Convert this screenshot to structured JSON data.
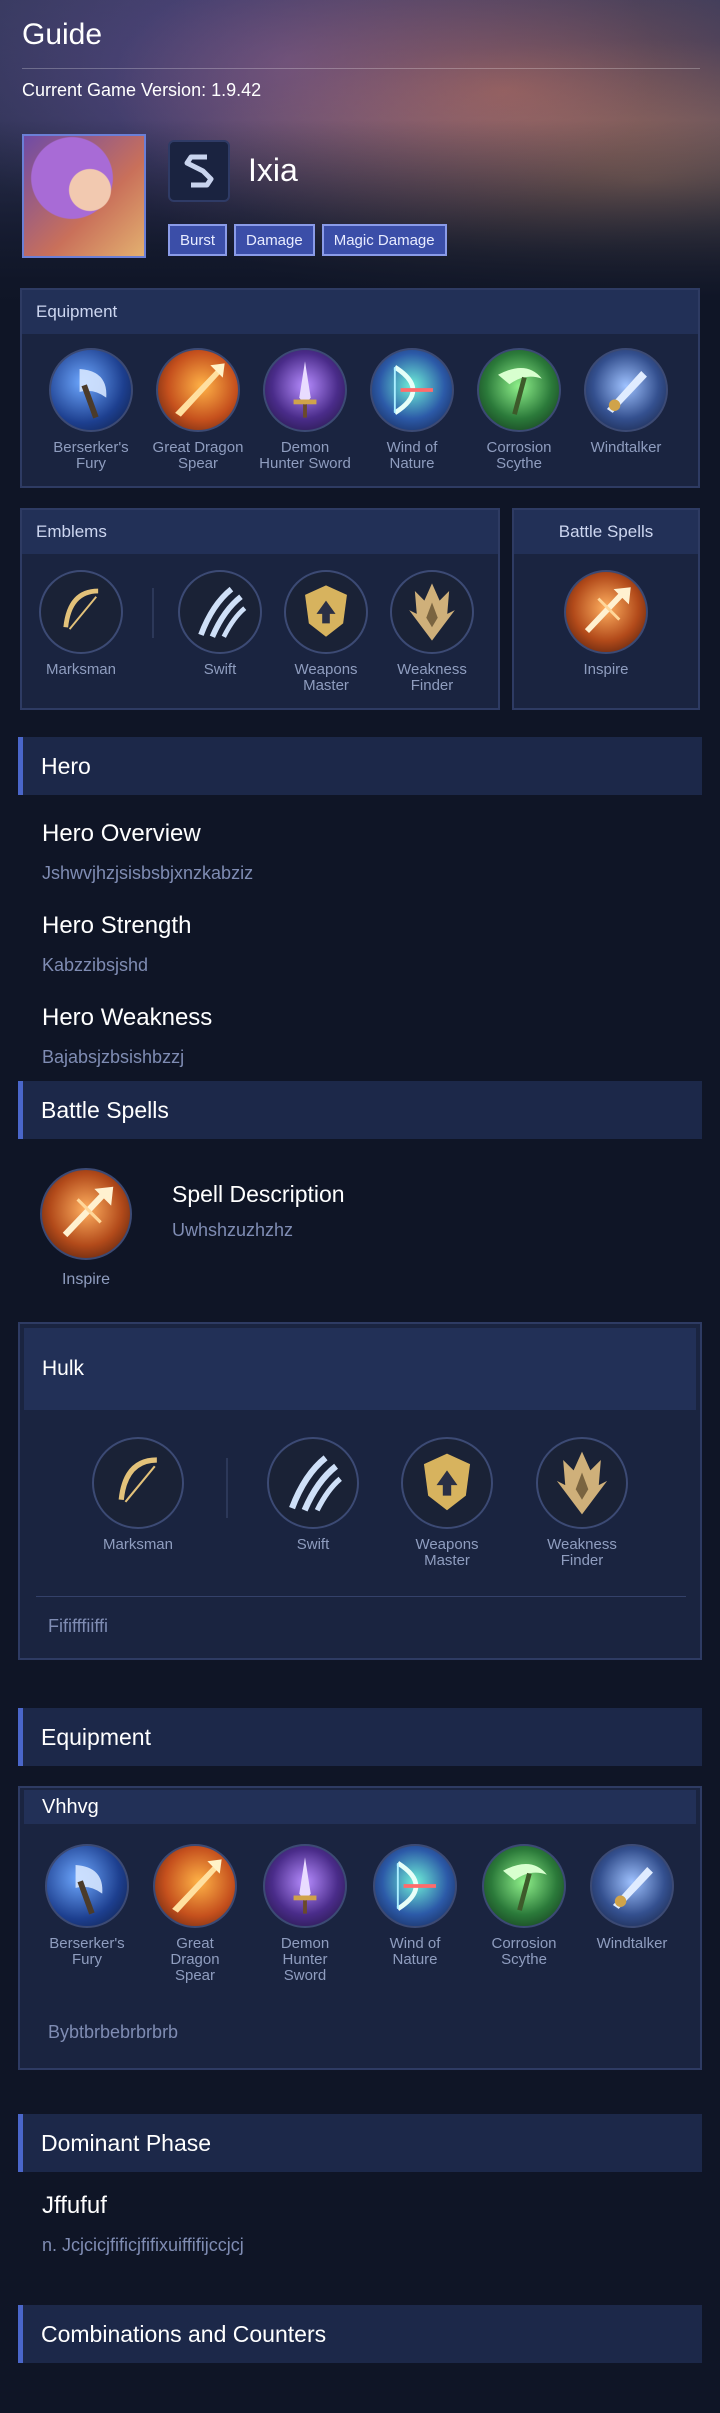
{
  "header": {
    "title": "Guide",
    "version": "Current Game Version: 1.9.42"
  },
  "hero": {
    "name": "Ixia",
    "tags": [
      "Burst",
      "Damage",
      "Magic Damage"
    ]
  },
  "equipment_panel": {
    "title": "Equipment",
    "items": [
      {
        "label": "Berserker's Fury",
        "lines": [
          "Berserker's",
          "Fury"
        ]
      },
      {
        "label": "Great Dragon Spear",
        "lines": [
          "Great Dragon",
          "Spear"
        ]
      },
      {
        "label": "Demon Hunter Sword",
        "lines": [
          "Demon",
          "Hunter Sword"
        ]
      },
      {
        "label": "Wind of Nature",
        "lines": [
          "Wind of",
          "Nature"
        ]
      },
      {
        "label": "Corrosion Scythe",
        "lines": [
          "Corrosion",
          "Scythe"
        ]
      },
      {
        "label": "Windtalker",
        "lines": [
          "Windtalker",
          ""
        ]
      }
    ]
  },
  "emblems_panel": {
    "title": "Emblems",
    "main": {
      "lines": [
        "Marksman",
        ""
      ]
    },
    "talents": [
      {
        "lines": [
          "Swift",
          ""
        ]
      },
      {
        "lines": [
          "Weapons",
          "Master"
        ]
      },
      {
        "lines": [
          "Weakness",
          "Finder"
        ]
      }
    ]
  },
  "battle_spells_panel": {
    "title": "Battle Spells",
    "spell": "Inspire"
  },
  "sections": {
    "hero": "Hero",
    "battle_spells": "Battle Spells",
    "equipment": "Equipment",
    "dominant_phase": "Dominant Phase",
    "combos": "Combinations and Counters"
  },
  "hero_info": {
    "overview_title": "Hero Overview",
    "overview_text": "Jshwvjhzjsisbsbjxnzkabziz",
    "strength_title": "Hero Strength",
    "strength_text": "Kabzzibsjshd",
    "weakness_title": "Hero Weakness",
    "weakness_text": "Bajabsjzbsishbzzj"
  },
  "spell_info": {
    "name": "Inspire",
    "desc_title": "Spell Description",
    "desc_text": "Uwhshzuzhzhz"
  },
  "emblem_build": {
    "title": "Hulk",
    "main": {
      "lines": [
        "Marksman",
        ""
      ]
    },
    "talents": [
      {
        "lines": [
          "Swift",
          ""
        ]
      },
      {
        "lines": [
          "Weapons",
          "Master"
        ]
      },
      {
        "lines": [
          "Weakness",
          "Finder"
        ]
      }
    ],
    "note": "Fififffiiffi"
  },
  "equipment_build": {
    "title": "Vhhvg",
    "items": [
      {
        "lines": [
          "Berserker's",
          "Fury",
          ""
        ]
      },
      {
        "lines": [
          "Great",
          "Dragon",
          "Spear"
        ]
      },
      {
        "lines": [
          "Demon",
          "Hunter",
          "Sword"
        ]
      },
      {
        "lines": [
          "Wind of",
          "Nature",
          ""
        ]
      },
      {
        "lines": [
          "Corrosion",
          "Scythe",
          ""
        ]
      },
      {
        "lines": [
          "Windtalker",
          "",
          ""
        ]
      }
    ],
    "note": "Bybtbrbebrbrbrb"
  },
  "dominant_phase": {
    "title": "Jffufuf",
    "text": "n. Jcjcicjfificjfifixuiffifijccjcj"
  },
  "colors": {
    "accent": "#4a66c9",
    "panel": "#1a2440",
    "tag": "#3b4ea8",
    "muted_text": "#7f8cb3"
  },
  "icons": {
    "berserkers_fury": "axe-icon",
    "great_dragon_spear": "spear-icon",
    "demon_hunter_sword": "sword-icon",
    "wind_of_nature": "bow-icon",
    "corrosion_scythe": "scythe-icon",
    "windtalker": "blade-icon",
    "marksman": "bow-emblem-icon",
    "swift": "claw-icon",
    "weapons_master": "shield-arrow-icon",
    "weakness_finder": "trident-emblem-icon",
    "inspire": "inspire-spell-icon"
  }
}
